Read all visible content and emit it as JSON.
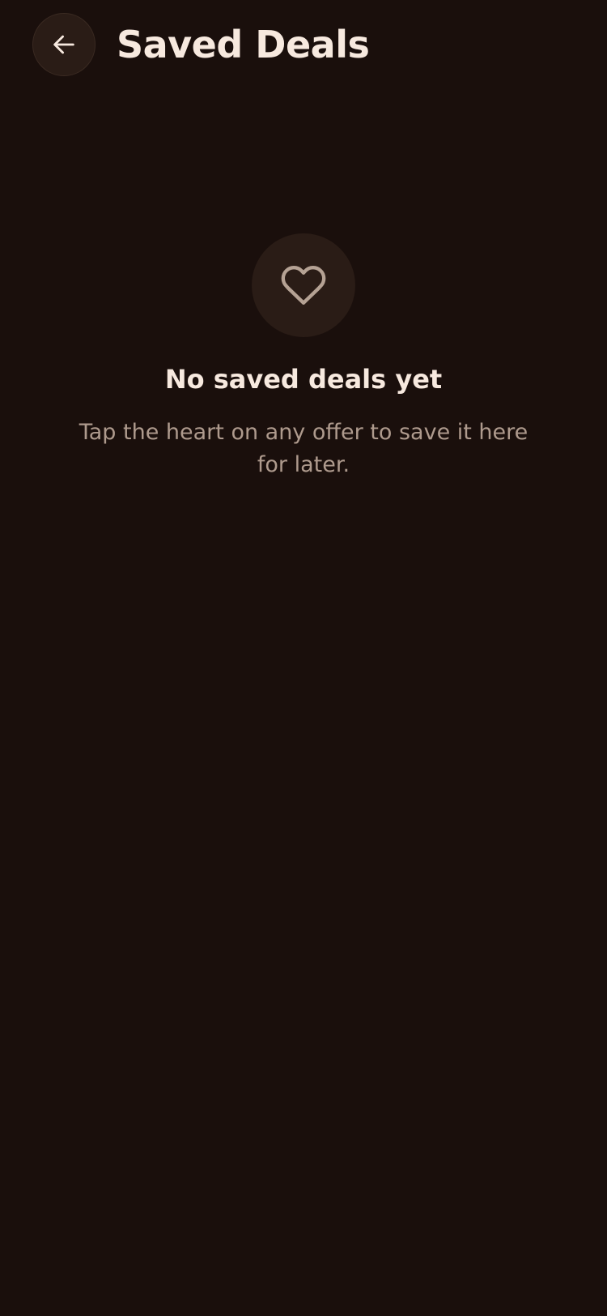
{
  "header": {
    "title": "Saved Deals",
    "back_icon": "arrow-left-icon"
  },
  "empty_state": {
    "icon": "heart-outline-icon",
    "title": "No saved deals yet",
    "description": "Tap the heart on any offer to save it here for later."
  },
  "colors": {
    "background": "#1a0f0c",
    "surface": "#2a1c16",
    "text_primary": "#f7e9df",
    "text_secondary": "#ae9a8d",
    "icon_muted": "#b5a294"
  }
}
